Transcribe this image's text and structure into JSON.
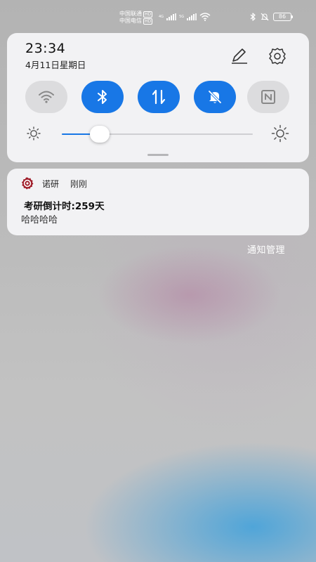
{
  "status_bar": {
    "carrier1": "中国联通",
    "carrier2": "中国电信",
    "hd_badge": "HD",
    "net_4g": "4G",
    "net_5g": "5G",
    "battery": "86",
    "icons": [
      "signal-icon",
      "wifi-status-icon",
      "bluetooth-status-icon",
      "mute-status-icon",
      "battery-icon"
    ]
  },
  "quick_settings": {
    "time": "23:34",
    "date": "4月11日星期日",
    "toggles": [
      {
        "name": "wifi",
        "icon": "wifi-icon",
        "active": false
      },
      {
        "name": "bluetooth",
        "icon": "bluetooth-icon",
        "active": true
      },
      {
        "name": "mobile-data",
        "icon": "data-transfer-icon",
        "active": true
      },
      {
        "name": "silent",
        "icon": "bell-off-icon",
        "active": true
      },
      {
        "name": "nfc",
        "icon": "nfc-icon",
        "active": false
      }
    ],
    "brightness": 0.2,
    "accent_color": "#1877e6"
  },
  "notification": {
    "app_name": "诺研",
    "time": "刚刚",
    "title": "考研倒计时:259天",
    "body": "哈哈哈哈"
  },
  "notification_manage": "通知管理"
}
